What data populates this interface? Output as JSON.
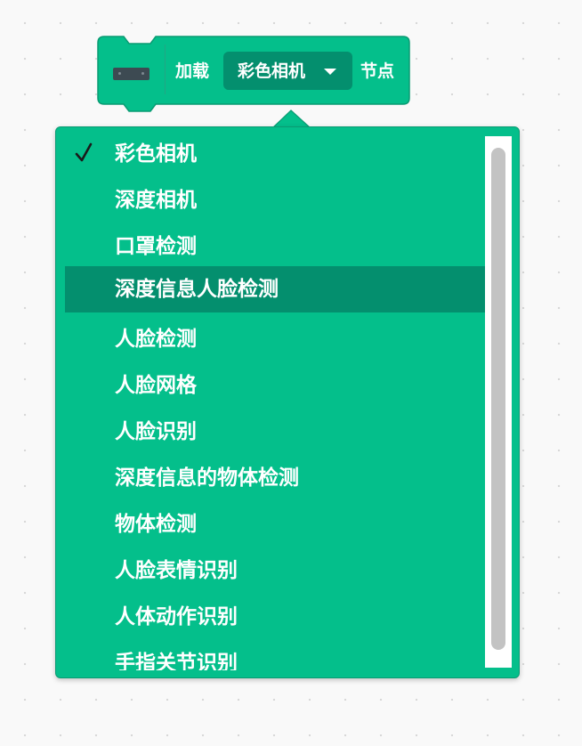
{
  "block": {
    "label_load": "加载",
    "dropdown_value": "彩色相机",
    "label_node": "节点",
    "icon": "camera-icon",
    "colors": {
      "block_fill": "#04bf8b",
      "block_border": "#0a9b73",
      "dropdown_fill": "#048f6e"
    }
  },
  "menu": {
    "items": [
      {
        "label": "彩色相机",
        "selected": true
      },
      {
        "label": "深度相机"
      },
      {
        "label": "口罩检测"
      },
      {
        "label": "深度信息人脸检测",
        "hovered": true
      },
      {
        "label": "人脸检测"
      },
      {
        "label": "人脸网格"
      },
      {
        "label": "人脸识别"
      },
      {
        "label": "深度信息的物体检测"
      },
      {
        "label": "物体检测"
      },
      {
        "label": "人脸表情识别"
      },
      {
        "label": "人体动作识别"
      },
      {
        "label": "手指关节识别"
      }
    ],
    "colors": {
      "background": "#04bf8b",
      "hover": "#048f6e",
      "text": "#ffffff",
      "check": "#1a1a1a"
    }
  }
}
